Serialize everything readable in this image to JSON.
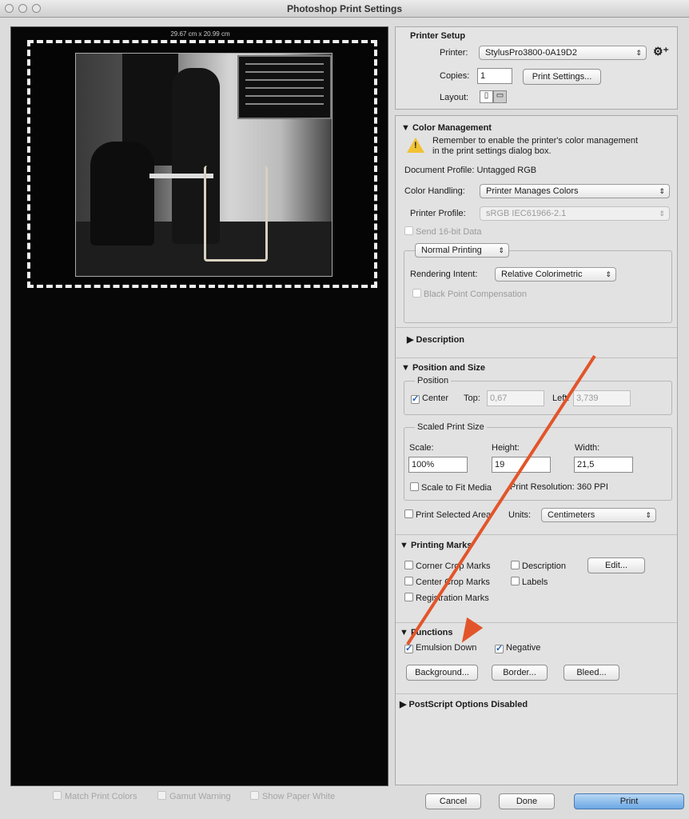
{
  "window": {
    "title": "Photoshop Print Settings"
  },
  "preview": {
    "paper_size": "29.67 cm x 20.99 cm"
  },
  "printer_setup": {
    "title": "Printer Setup",
    "printer_label": "Printer:",
    "printer_value": "StylusPro3800-0A19D2",
    "copies_label": "Copies:",
    "copies_value": "1",
    "print_settings_button": "Print Settings...",
    "layout_label": "Layout:"
  },
  "color_management": {
    "title": "Color Management",
    "warning_text": "Remember to enable the printer's color management in the print settings dialog box.",
    "document_profile": "Document Profile: Untagged RGB",
    "color_handling_label": "Color Handling:",
    "color_handling_value": "Printer Manages Colors",
    "printer_profile_label": "Printer Profile:",
    "printer_profile_value": "sRGB IEC61966-2.1",
    "send_16bit": "Send 16-bit Data",
    "normal_printing": "Normal Printing",
    "rendering_intent_label": "Rendering Intent:",
    "rendering_intent_value": "Relative Colorimetric",
    "black_point": "Black Point Compensation"
  },
  "description": {
    "title": "Description"
  },
  "position_size": {
    "title": "Position and Size",
    "position_legend": "Position",
    "center_label": "Center",
    "top_label": "Top:",
    "top_value": "0,67",
    "left_label": "Left:",
    "left_value": "3,739",
    "scaled_legend": "Scaled Print Size",
    "scale_label": "Scale:",
    "scale_value": "100%",
    "height_label": "Height:",
    "height_value": "19",
    "width_label": "Width:",
    "width_value": "21,5",
    "scale_to_fit": "Scale to Fit Media",
    "print_resolution": "Print Resolution: 360 PPI",
    "print_selected_area": "Print Selected Area",
    "units_label": "Units:",
    "units_value": "Centimeters"
  },
  "printing_marks": {
    "title": "Printing Marks",
    "corner_crop": "Corner Crop Marks",
    "center_crop": "Center Crop Marks",
    "registration": "Registration Marks",
    "description": "Description",
    "labels": "Labels",
    "edit_button": "Edit..."
  },
  "functions": {
    "title": "Functions",
    "emulsion_down": "Emulsion Down",
    "negative": "Negative",
    "background_button": "Background...",
    "border_button": "Border...",
    "bleed_button": "Bleed..."
  },
  "postscript": {
    "title": "PostScript Options Disabled"
  },
  "bottom": {
    "match_print_colors": "Match Print Colors",
    "gamut_warning": "Gamut Warning",
    "show_paper_white": "Show Paper White",
    "cancel": "Cancel",
    "done": "Done",
    "print": "Print"
  },
  "colors": {
    "annotation_arrow": "#e2552a",
    "warning": "#f1c232",
    "default_button": "#6aa7e4"
  }
}
